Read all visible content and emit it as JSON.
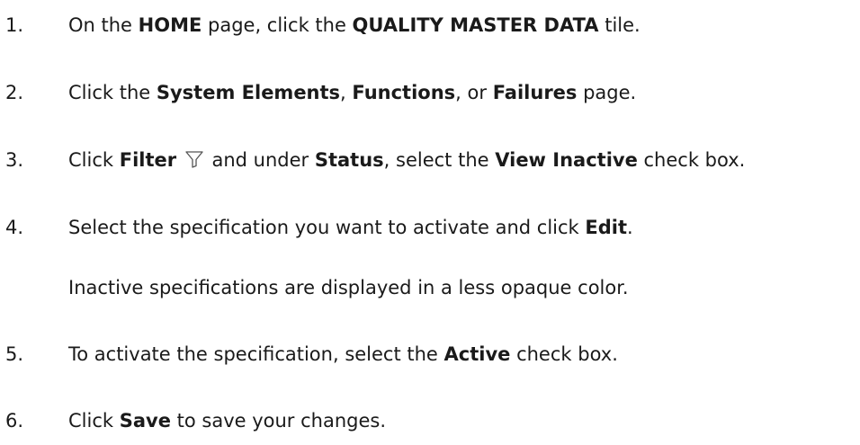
{
  "steps": [
    {
      "number": "1.",
      "parts": [
        "On the ",
        "HOME",
        " page, click the ",
        "QUALITY MASTER DATA",
        " tile."
      ]
    },
    {
      "number": "2.",
      "parts": [
        "Click the ",
        "System Elements",
        ", ",
        "Functions",
        ", or ",
        "Failures",
        " page."
      ]
    },
    {
      "number": "3.",
      "parts": [
        "Click ",
        "Filter",
        " and under ",
        "Status",
        ", select the ",
        "View Inactive",
        " check box."
      ],
      "icon": "filter-icon"
    },
    {
      "number": "4.",
      "parts": [
        "Select the specification you want to activate and click ",
        "Edit",
        "."
      ],
      "note": "Inactive specifications are displayed in a less opaque color."
    },
    {
      "number": "5.",
      "parts": [
        "To activate the specification, select the ",
        "Active",
        " check box."
      ]
    },
    {
      "number": "6.",
      "parts": [
        "Click ",
        "Save",
        " to save your changes."
      ]
    }
  ]
}
